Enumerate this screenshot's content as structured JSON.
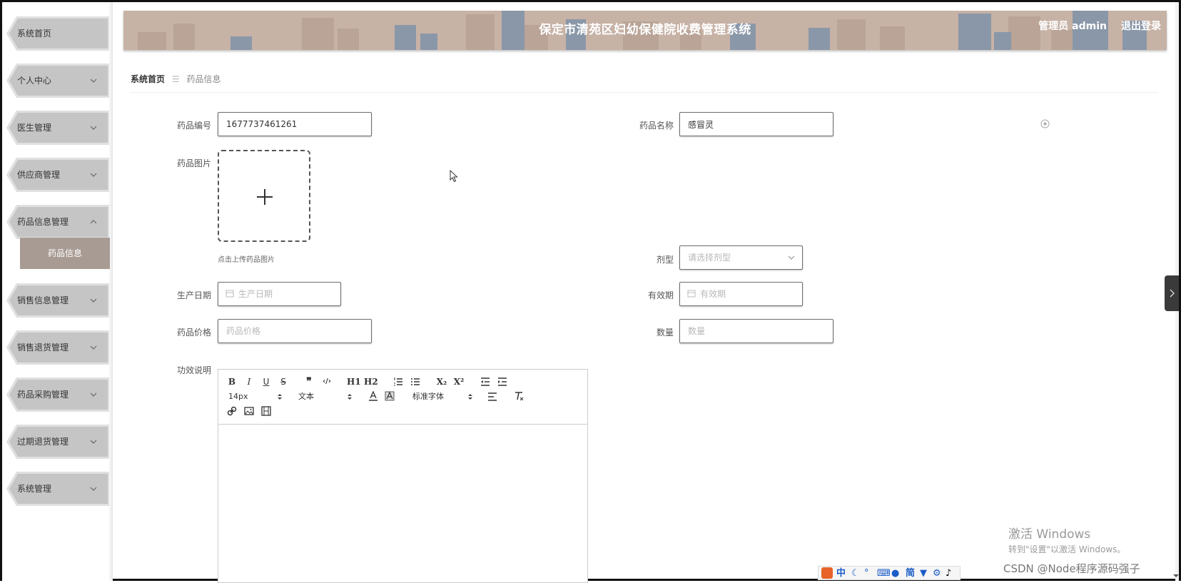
{
  "header": {
    "title": "保定市清苑区妇幼保健院收费管理系统",
    "user_label": "管理员 admin",
    "logout_label": "退出登录"
  },
  "sidebar": {
    "items": [
      {
        "label": "系统首页",
        "has_chevron": false
      },
      {
        "label": "个人中心",
        "has_chevron": true
      },
      {
        "label": "医生管理",
        "has_chevron": true
      },
      {
        "label": "供应商管理",
        "has_chevron": true
      },
      {
        "label": "药品信息管理",
        "has_chevron": true,
        "expanded": true
      },
      {
        "label": "销售信息管理",
        "has_chevron": true
      },
      {
        "label": "销售退货管理",
        "has_chevron": true
      },
      {
        "label": "药品采购管理",
        "has_chevron": true
      },
      {
        "label": "过期退货管理",
        "has_chevron": true
      },
      {
        "label": "系统管理",
        "has_chevron": true
      }
    ],
    "submenu_active": "药品信息"
  },
  "breadcrumb": {
    "home": "系统首页",
    "separator": "☰",
    "current": "药品信息"
  },
  "form": {
    "code_label": "药品编号",
    "code_value": "1677737461261",
    "name_label": "药品名称",
    "name_value": "感冒灵",
    "image_label": "药品图片",
    "upload_tip": "点击上传药品图片",
    "dosage_label": "剂型",
    "dosage_placeholder": "请选择剂型",
    "prod_date_label": "生产日期",
    "prod_date_placeholder": "生产日期",
    "expiry_label": "有效期",
    "expiry_placeholder": "有效期",
    "price_label": "药品价格",
    "price_placeholder": "药品价格",
    "qty_label": "数量",
    "qty_placeholder": "数量",
    "desc_label": "功效说明"
  },
  "editor": {
    "size_select": "14px",
    "header_select": "文本",
    "font_select": "标准字体",
    "buttons": [
      "B",
      "I",
      "U",
      "S",
      "❞",
      "‹/›",
      "H1",
      "H2",
      "ordered-list",
      "bullet-list",
      "X₂",
      "X²",
      "outdent",
      "indent",
      "font-color",
      "background-color",
      "align",
      "clean",
      "link",
      "image",
      "video"
    ]
  },
  "watermark": {
    "windows_line1": "激活 Windows",
    "windows_line2": "转到\"设置\"以激活 Windows。",
    "csdn": "CSDN @Node程序源码强子"
  },
  "ime": {
    "items": [
      "中",
      "简"
    ]
  },
  "colors": {
    "header_bg": "#c7b2a6",
    "submenu_active_bg": "#a89b94",
    "menu_bg": "#c5c5c5"
  }
}
